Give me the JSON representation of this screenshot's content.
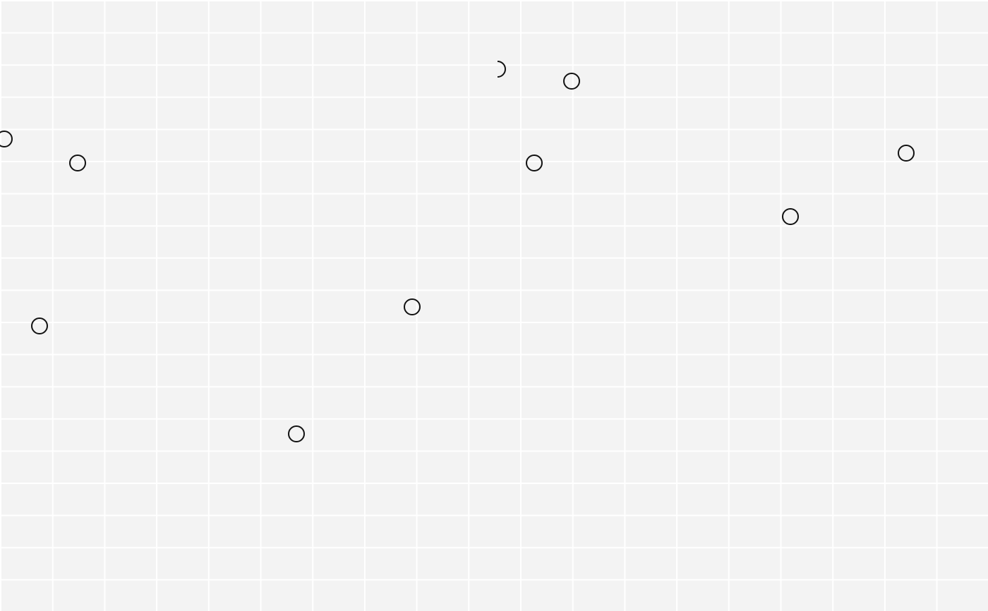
{
  "canvas": {
    "background_color": "#f3f3f3",
    "grid_color": "#ffffff",
    "node_stroke_color": "#111111",
    "grid_visible": true
  },
  "nodes": [
    {
      "id": "node-1",
      "shape": "circle"
    },
    {
      "id": "node-2",
      "shape": "circle"
    },
    {
      "id": "node-3",
      "shape": "circle"
    },
    {
      "id": "node-4",
      "shape": "circle"
    },
    {
      "id": "node-5",
      "shape": "circle"
    },
    {
      "id": "node-6",
      "shape": "circle"
    },
    {
      "id": "node-7",
      "shape": "circle"
    },
    {
      "id": "node-8",
      "shape": "circle"
    },
    {
      "id": "node-9",
      "shape": "circle"
    },
    {
      "id": "node-10",
      "shape": "circle"
    },
    {
      "id": "node-11",
      "shape": "circle"
    }
  ]
}
